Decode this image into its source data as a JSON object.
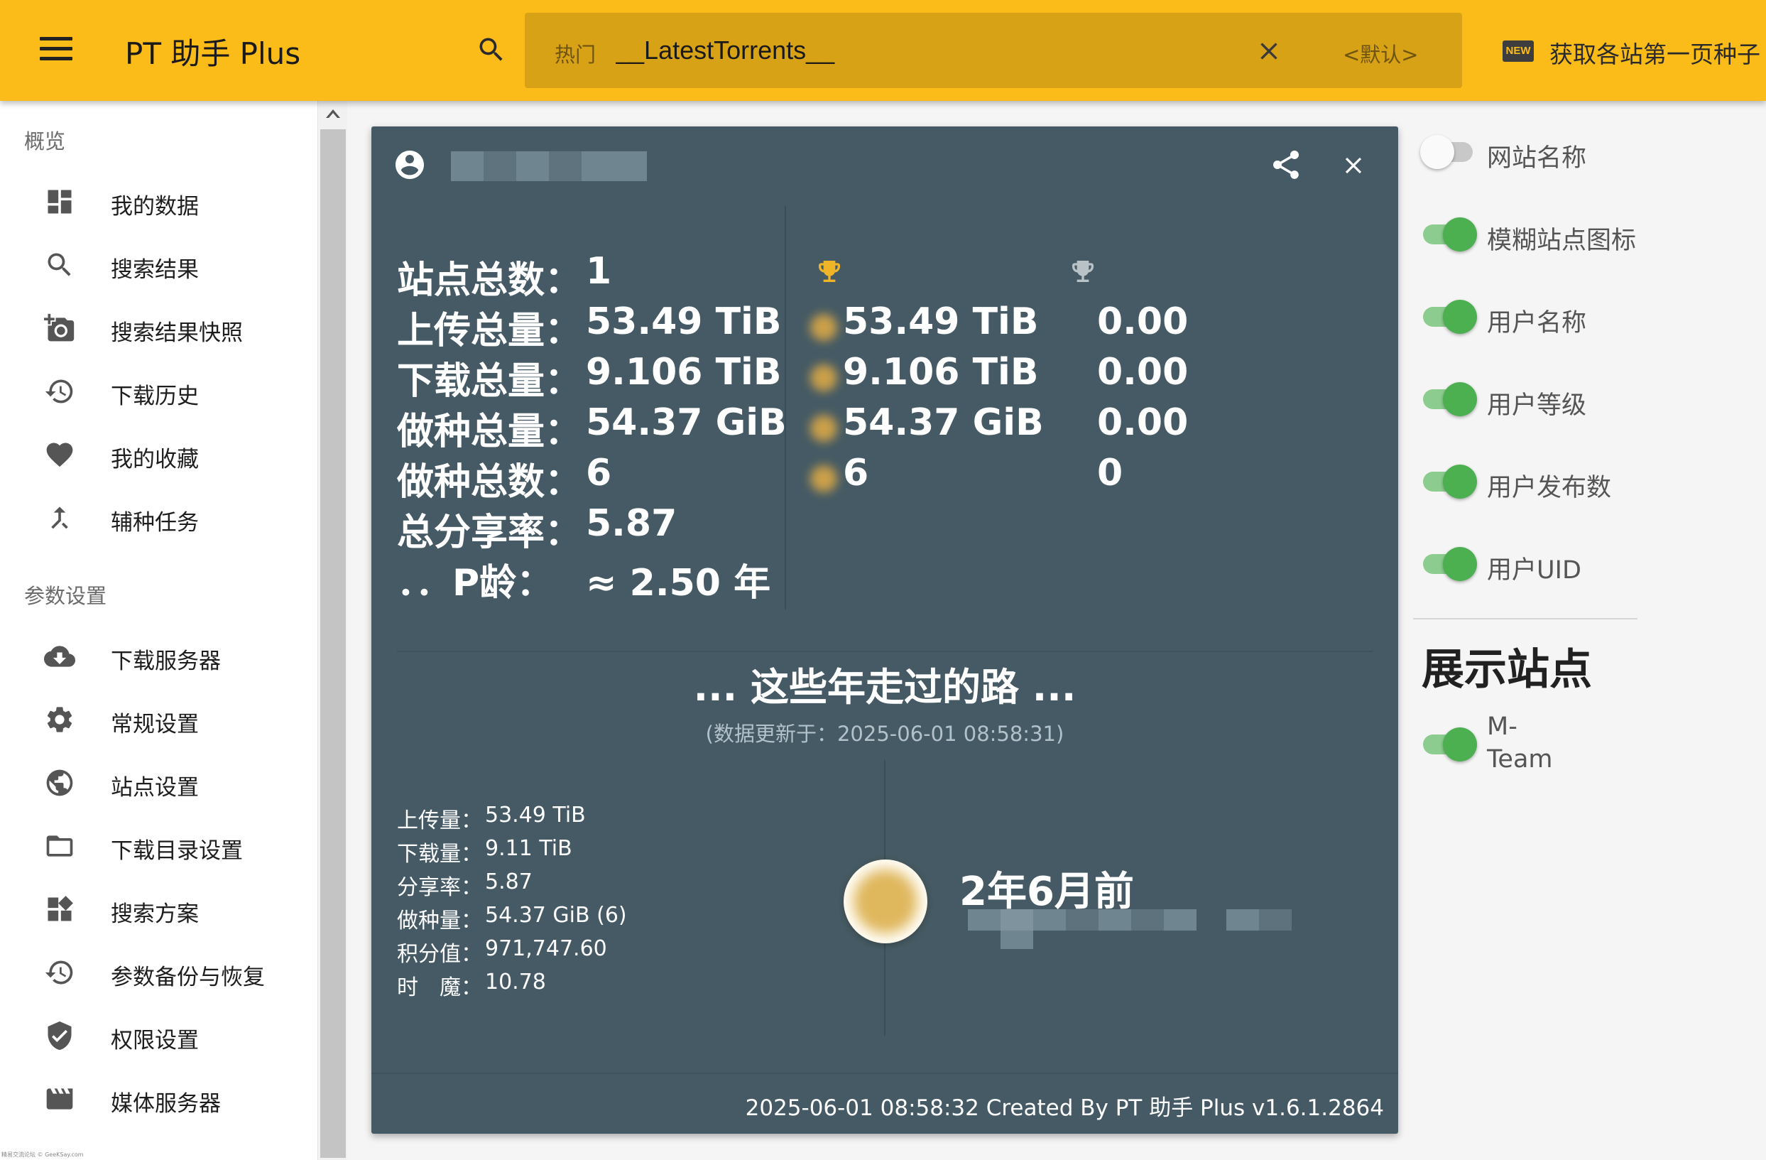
{
  "topbar": {
    "app_title": "PT 助手 Plus",
    "search_prefix": "热门",
    "search_value": "__LatestTorrents__",
    "scope_label": "<默认>",
    "new_badge": "NEW",
    "fetch_label": "获取各站第一页种子",
    "accent_color": "#fbbc1a"
  },
  "sidebar": {
    "overview_title": "概览",
    "overview_items": [
      {
        "label": "我的数据",
        "icon": "dashboard-icon"
      },
      {
        "label": "搜索结果",
        "icon": "search-icon"
      },
      {
        "label": "搜索结果快照",
        "icon": "add-photo-icon"
      },
      {
        "label": "下载历史",
        "icon": "history-icon"
      },
      {
        "label": "我的收藏",
        "icon": "heart-icon"
      },
      {
        "label": "辅种任务",
        "icon": "merge-icon"
      }
    ],
    "settings_title": "参数设置",
    "settings_items": [
      {
        "label": "下载服务器",
        "icon": "cloud-download-icon"
      },
      {
        "label": "常规设置",
        "icon": "gear-icon"
      },
      {
        "label": "站点设置",
        "icon": "globe-icon"
      },
      {
        "label": "下载目录设置",
        "icon": "folder-icon"
      },
      {
        "label": "搜索方案",
        "icon": "widgets-icon"
      },
      {
        "label": "参数备份与恢复",
        "icon": "restore-icon"
      },
      {
        "label": "权限设置",
        "icon": "shield-check-icon"
      },
      {
        "label": "媒体服务器",
        "icon": "movie-icon"
      }
    ],
    "watermark": "精易交流论坛 © GeeKSay.com"
  },
  "card": {
    "summary": [
      {
        "key": "站点总数：",
        "value": "1"
      },
      {
        "key": "上传总量：",
        "value": "53.49 TiB"
      },
      {
        "key": "下载总量：",
        "value": "9.106 TiB"
      },
      {
        "key": "做种总量：",
        "value": "54.37 GiB"
      },
      {
        "key": "做种总数：",
        "value": "6"
      },
      {
        "key": "总分享率：",
        "value": "5.87"
      },
      {
        "key": "．．P龄：",
        "value": "≈ 2.50 年"
      }
    ],
    "gold_column": [
      "53.49 TiB",
      "9.106 TiB",
      "54.37 GiB",
      "6"
    ],
    "silver_column": [
      "0.00",
      "0.00",
      "0.00",
      "0"
    ],
    "journey_title": "... 这些年走过的路 ...",
    "journey_updated": "(数据更新于：2025-06-01 08:58:31)",
    "details": [
      {
        "key": "上传量：",
        "value": "53.49 TiB"
      },
      {
        "key": "下载量：",
        "value": "9.11 TiB"
      },
      {
        "key": "分享率：",
        "value": "5.87"
      },
      {
        "key": "做种量：",
        "value": "54.37 GiB (6)"
      },
      {
        "key": "积分值：",
        "value": "971,747.60"
      },
      {
        "key": "时　魔：",
        "value": "10.78"
      }
    ],
    "time_ago": "2年6月前",
    "footer": "2025-06-01 08:58:32 Created By PT 助手 Plus v1.6.1.2864",
    "background_color": "#455a64"
  },
  "panel": {
    "toggles": [
      {
        "label": "网站名称",
        "on": false
      },
      {
        "label": "模糊站点图标",
        "on": true
      },
      {
        "label": "用户名称",
        "on": true
      },
      {
        "label": "用户等级",
        "on": true
      },
      {
        "label": "用户发布数",
        "on": true
      },
      {
        "label": "用户UID",
        "on": true
      }
    ],
    "heading": "展示站点",
    "sites": [
      {
        "label": "M-Team",
        "on": true
      }
    ],
    "switch_on_color": "#4caf50"
  }
}
